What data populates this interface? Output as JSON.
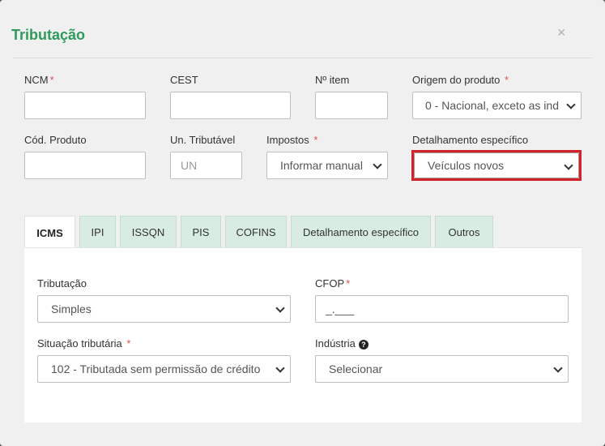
{
  "modal": {
    "title": "Tributação",
    "close_symbol": "×"
  },
  "row1": {
    "ncm_label": "NCM",
    "ncm_value": "",
    "cest_label": "CEST",
    "cest_value": "",
    "item_label": "Nº item",
    "item_value": "",
    "origem_label": "Origem do produto",
    "origem_value": "0 - Nacional, exceto as ind"
  },
  "row2": {
    "cod_label": "Cód. Produto",
    "cod_value": "",
    "un_label": "Un. Tributável",
    "un_placeholder": "UN",
    "impostos_label": "Impostos",
    "impostos_value": "Informar manual",
    "detalhamento_label": "Detalhamento específico",
    "detalhamento_value": "Veículos novos"
  },
  "required_mark": "*",
  "tabs": [
    {
      "label": "ICMS",
      "active": true
    },
    {
      "label": "IPI",
      "active": false
    },
    {
      "label": "ISSQN",
      "active": false
    },
    {
      "label": "PIS",
      "active": false
    },
    {
      "label": "COFINS",
      "active": false
    },
    {
      "label": "Detalhamento específico",
      "active": false
    },
    {
      "label": "Outros",
      "active": false
    }
  ],
  "icms": {
    "tributacao_label": "Tributação",
    "tributacao_value": "Simples",
    "cfop_label": "CFOP",
    "cfop_placeholder": "_.___",
    "situacao_label": "Situação tributária",
    "situacao_value": "102 - Tributada sem permissão de crédito",
    "industria_label": "Indústria",
    "industria_value": "Selecionar"
  },
  "colors": {
    "title_green": "#2e9a5b",
    "required_red": "#d9534f",
    "highlight_red": "#d6202a",
    "tab_green": "#d8ece1"
  }
}
